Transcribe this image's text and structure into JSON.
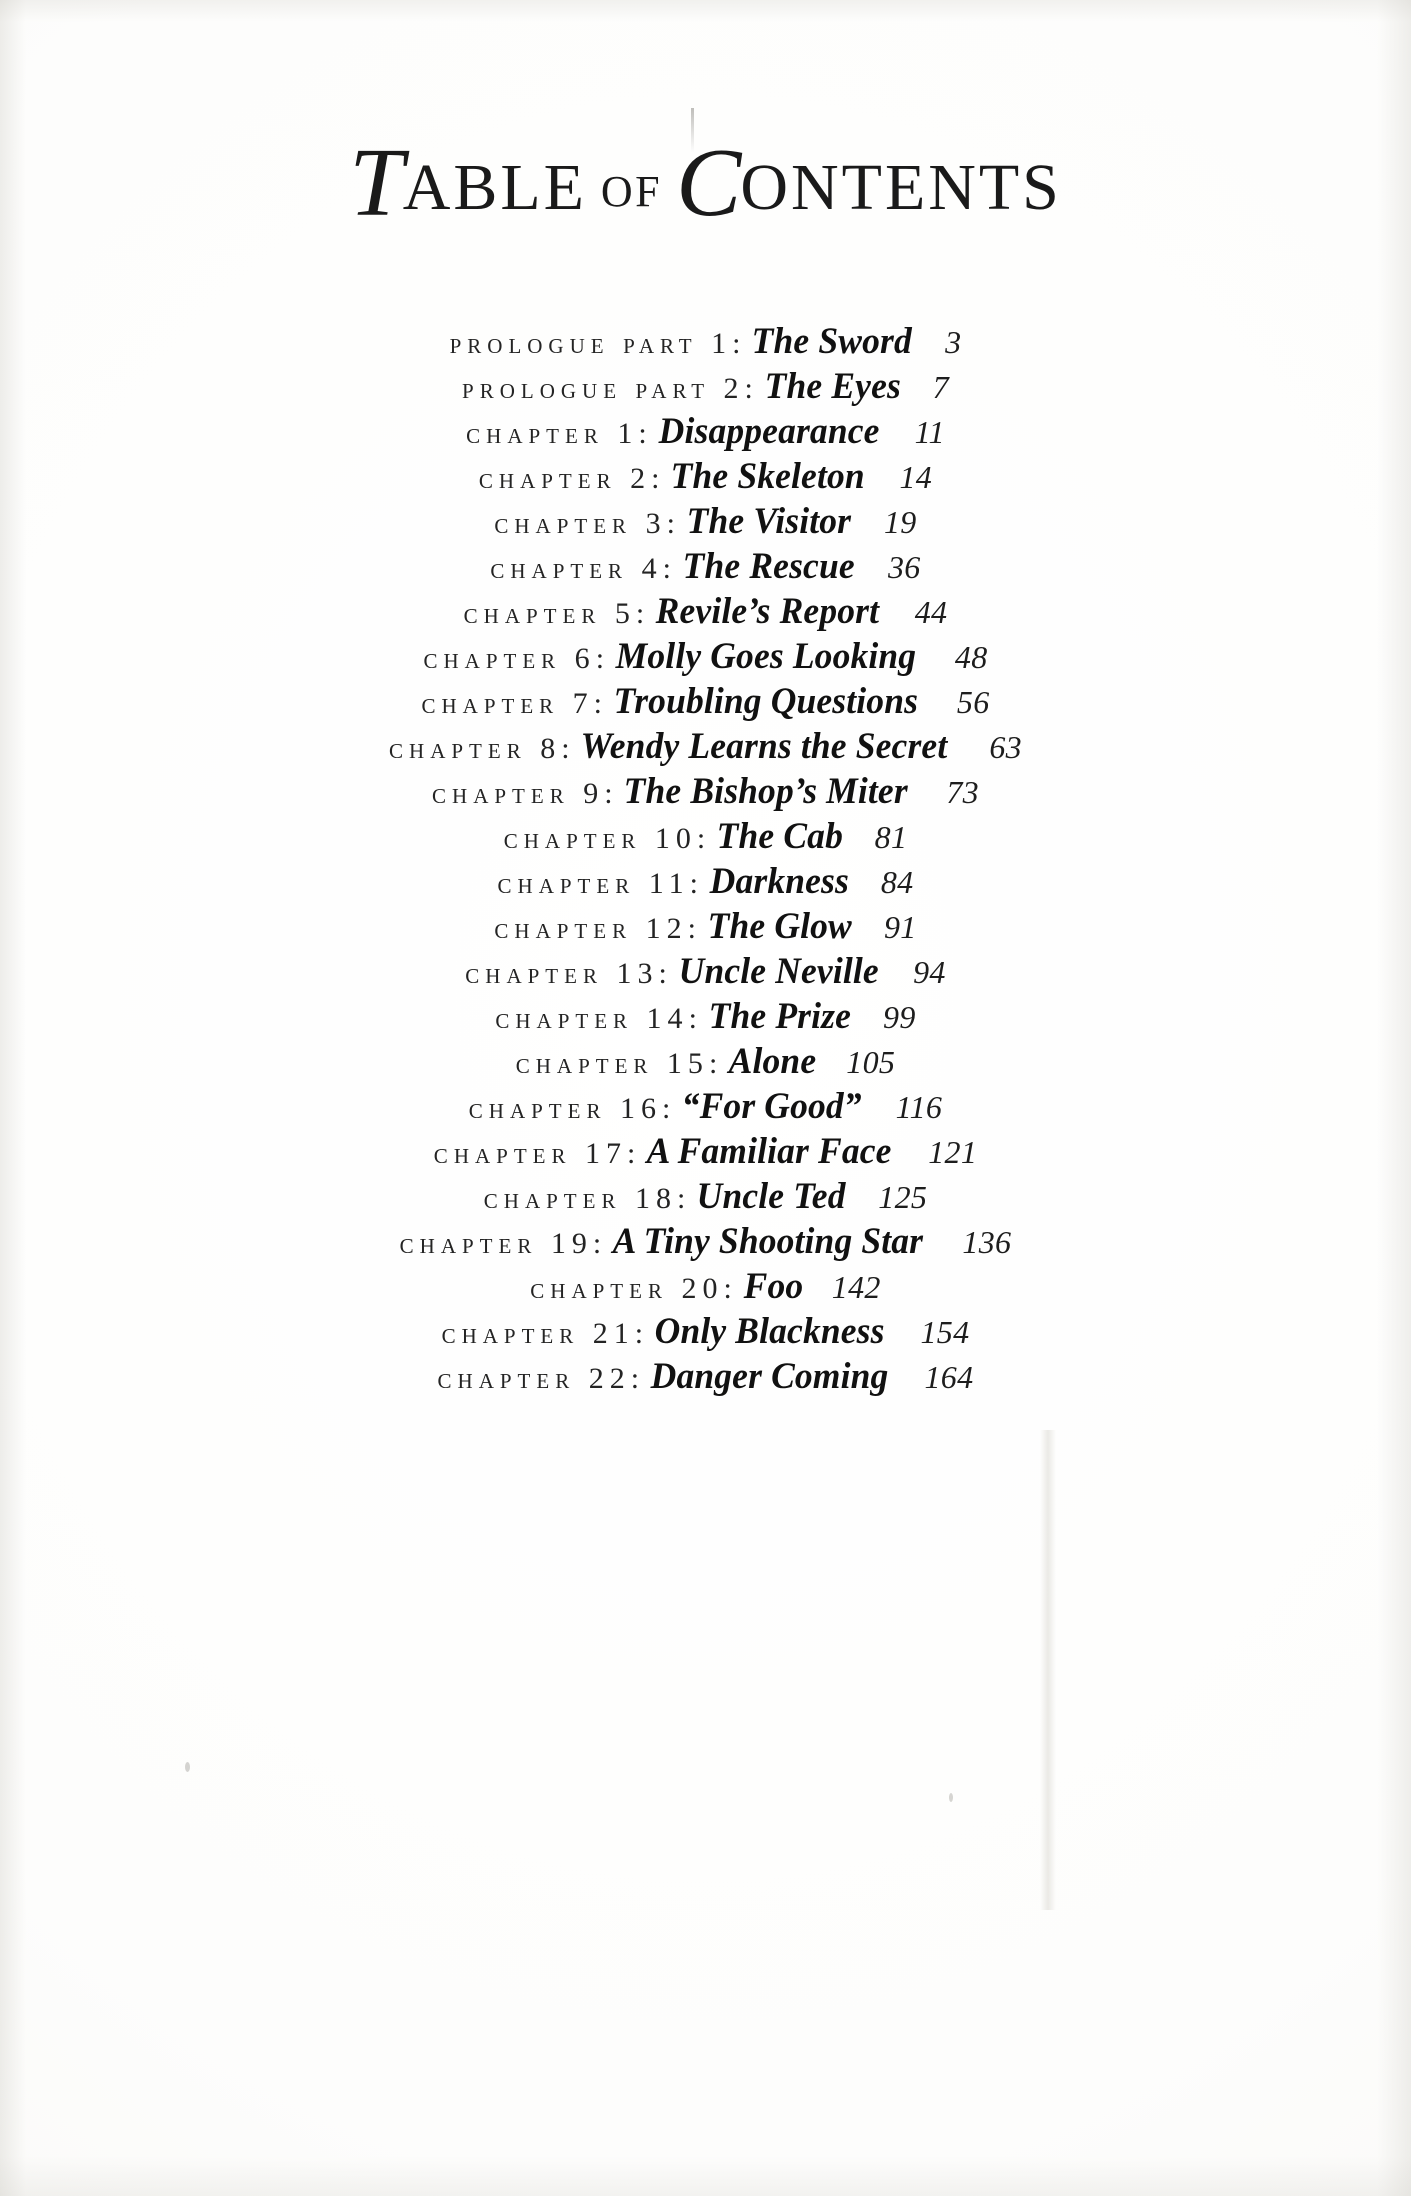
{
  "page": {
    "title_parts": {
      "t_swash": "T",
      "able": "ABLE",
      "of": "OF",
      "c_swash": "C",
      "ontents": "ONTENTS"
    },
    "title_full": "TABLE OF CONTENTS"
  },
  "entries": [
    {
      "label": "Prologue Part 1",
      "separator": ":",
      "title": "The Sword",
      "page": "3"
    },
    {
      "label": "Prologue Part 2",
      "separator": ":",
      "title": "The Eyes",
      "page": "7"
    },
    {
      "label": "Chapter 1",
      "separator": ":",
      "title": "Disappearance",
      "page": "11"
    },
    {
      "label": "Chapter 2",
      "separator": ":",
      "title": "The Skeleton",
      "page": "14"
    },
    {
      "label": "Chapter 3",
      "separator": ":",
      "title": "The Visitor",
      "page": "19"
    },
    {
      "label": "Chapter 4",
      "separator": ":",
      "title": "The Rescue",
      "page": "36"
    },
    {
      "label": "Chapter 5",
      "separator": ":",
      "title": "Revile’s Report",
      "page": "44"
    },
    {
      "label": "Chapter 6",
      "separator": ":",
      "title": "Molly Goes Looking",
      "page": "48"
    },
    {
      "label": "Chapter 7",
      "separator": ":",
      "title": "Troubling Questions",
      "page": "56"
    },
    {
      "label": "Chapter 8",
      "separator": ":",
      "title": "Wendy Learns the Secret",
      "page": "63"
    },
    {
      "label": "Chapter 9",
      "separator": ":",
      "title": "The Bishop’s Miter",
      "page": "73"
    },
    {
      "label": "Chapter 10",
      "separator": ":",
      "title": "The Cab",
      "page": "81"
    },
    {
      "label": "Chapter 11",
      "separator": ":",
      "title": "Darkness",
      "page": "84"
    },
    {
      "label": "Chapter 12",
      "separator": ":",
      "title": "The Glow",
      "page": "91"
    },
    {
      "label": "Chapter 13",
      "separator": ":",
      "title": "Uncle Neville",
      "page": "94"
    },
    {
      "label": "Chapter 14",
      "separator": ":",
      "title": "The Prize",
      "page": "99"
    },
    {
      "label": "Chapter 15",
      "separator": ":",
      "title": "Alone",
      "page": "105"
    },
    {
      "label": "Chapter 16",
      "separator": ":",
      "title": "“For Good”",
      "page": "116"
    },
    {
      "label": "Chapter 17",
      "separator": ":",
      "title": "A Familiar Face",
      "page": "121"
    },
    {
      "label": "Chapter 18",
      "separator": ":",
      "title": "Uncle Ted",
      "page": "125"
    },
    {
      "label": "Chapter 19",
      "separator": ":",
      "title": "A Tiny Shooting Star",
      "page": "136"
    },
    {
      "label": "Chapter 20",
      "separator": ":",
      "title": "Foo",
      "page": "142"
    },
    {
      "label": "Chapter 21",
      "separator": ":",
      "title": "Only Blackness",
      "page": "154"
    },
    {
      "label": "Chapter 22",
      "separator": ":",
      "title": "Danger Coming",
      "page": "164"
    }
  ],
  "colors": {
    "ink": "#1b1b1b",
    "paper": "#ffffff"
  }
}
